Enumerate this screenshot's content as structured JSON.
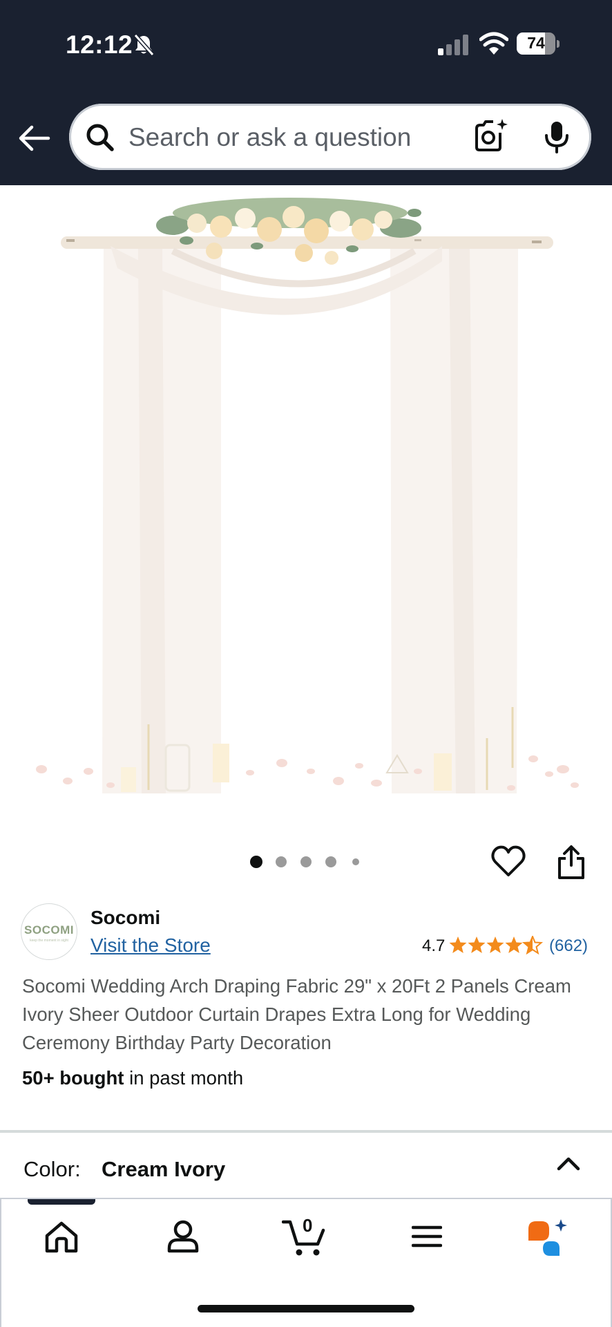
{
  "status_bar": {
    "time": "12:12",
    "battery": "74",
    "battery_level": 0.74
  },
  "search": {
    "placeholder": "Search or ask a question"
  },
  "gallery": {
    "image_count": 5,
    "active_index": 0
  },
  "brand": {
    "logo_text": "SOCOMI",
    "logo_subtext": "keep the moment in sight",
    "name": "Socomi",
    "store_link": "Visit the Store"
  },
  "rating": {
    "value": "4.7",
    "stars": 4.7,
    "count": "(662)"
  },
  "product": {
    "title": "Socomi Wedding Arch Draping Fabric 29\" x 20Ft 2 Panels Cream Ivory Sheer Outdoor Curtain Drapes Extra Long for Wedding Ceremony Birthday Party Decoration",
    "bought_bold": "50+ bought",
    "bought_rest": " in past month"
  },
  "color_selector": {
    "label": "Color:",
    "value": "Cream Ivory"
  },
  "bottom_nav": {
    "cart_count": "0",
    "items": [
      "home-icon",
      "account-icon",
      "cart-icon",
      "menu-icon",
      "rufus-icon"
    ]
  },
  "colors": {
    "header_bg": "#1a2130",
    "link": "#2162a1",
    "star": "#f38b1c",
    "rufus_orange": "#f06b14",
    "rufus_blue": "#1e8fe0"
  }
}
